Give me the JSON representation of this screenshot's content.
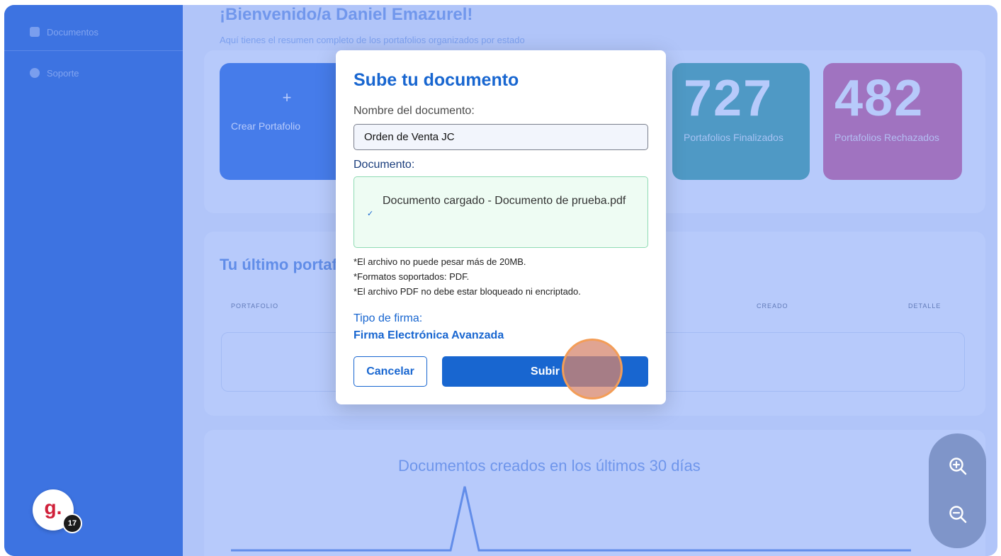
{
  "sidebar": {
    "items": [
      {
        "label": "Documentos"
      },
      {
        "label": "Soporte"
      }
    ]
  },
  "dashboard": {
    "welcome_title": "¡Bienvenido/a Daniel Emazurel!",
    "welcome_sub": "Aquí tienes el resumen completo de los portafolios organizados por estado",
    "create_card": {
      "plus": "+",
      "label": "Crear Portafolio"
    },
    "stats": [
      {
        "value": "727",
        "label": "Portafolios Finalizados",
        "color": "#3fa49b"
      },
      {
        "value": "482",
        "label": "Portafolios Rechazados",
        "color": "#d45f93"
      }
    ],
    "recent_title": "Tu último portafolio",
    "table_headers": [
      "PORTAFOLIO",
      "CREADO",
      "DETALLE"
    ],
    "chart_title": "Documentos creados en los últimos 30 días"
  },
  "dialog": {
    "title": "Sube tu documento",
    "name_label": "Nombre del documento:",
    "name_value": "Orden de Venta JC",
    "doc_label": "Documento:",
    "upload_status": "Documento cargado - Documento de prueba.pdf",
    "notes": [
      "*El archivo no puede pesar más de 20MB.",
      "*Formatos soportados: PDF.",
      "*El archivo PDF no debe estar bloqueado ni encriptado."
    ],
    "signature_label": "Tipo de firma:",
    "signature_value": "Firma Electrónica Avanzada",
    "cancel_label": "Cancelar",
    "submit_label": "Subir"
  },
  "badge": {
    "logo": "g.",
    "count": "17"
  },
  "colors": {
    "primary": "#1866d0",
    "sidebar": "#1f5fd0",
    "success_bg": "#eefcf3",
    "success_border": "#8fdbb4"
  }
}
